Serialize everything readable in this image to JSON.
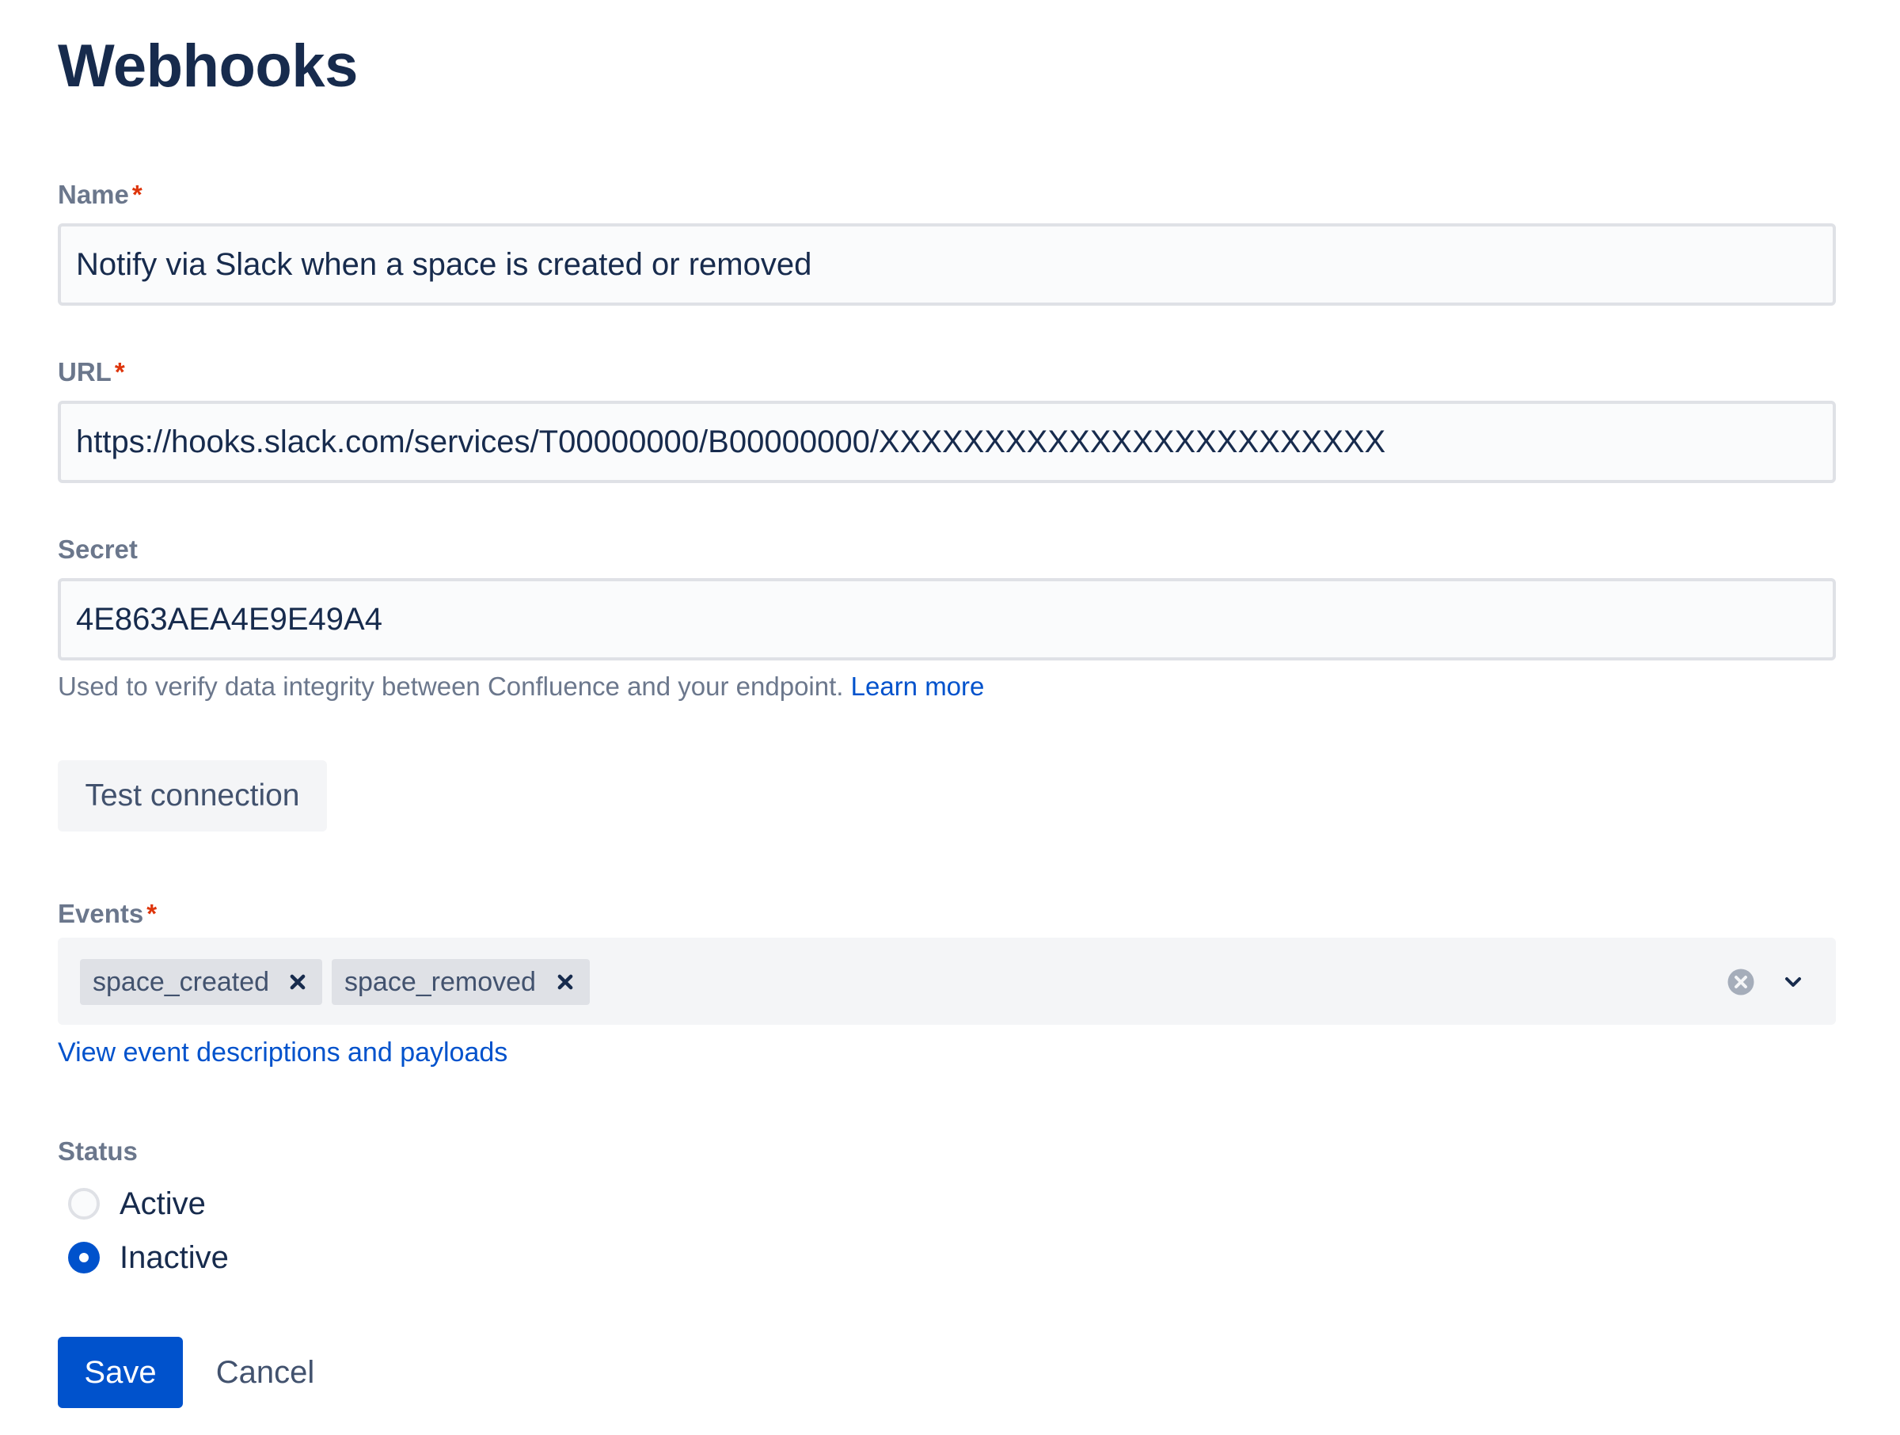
{
  "page": {
    "title": "Webhooks"
  },
  "form": {
    "name": {
      "label": "Name",
      "required_mark": "*",
      "value": "Notify via Slack when a space is created or removed"
    },
    "url": {
      "label": "URL",
      "required_mark": "*",
      "value": "https://hooks.slack.com/services/T00000000/B00000000/XXXXXXXXXXXXXXXXXXXXXXXX"
    },
    "secret": {
      "label": "Secret",
      "value": "4E863AEA4E9E49A4",
      "helper": "Used to verify data integrity between Confluence and your endpoint.",
      "helper_link": "Learn more"
    },
    "test_connection_label": "Test connection",
    "events": {
      "label": "Events",
      "required_mark": "*",
      "selected": [
        "space_created",
        "space_removed"
      ],
      "link": "View event descriptions and payloads",
      "icons": {
        "remove": "close-icon",
        "clear": "clear-circle-icon",
        "dropdown": "chevron-down-icon"
      }
    },
    "status": {
      "label": "Status",
      "options": [
        "Active",
        "Inactive"
      ],
      "selected": "Inactive"
    },
    "save_label": "Save",
    "cancel_label": "Cancel"
  },
  "colors": {
    "primary": "#0052CC",
    "text": "#172B4D",
    "label": "#6B778C",
    "required": "#DE350B"
  }
}
